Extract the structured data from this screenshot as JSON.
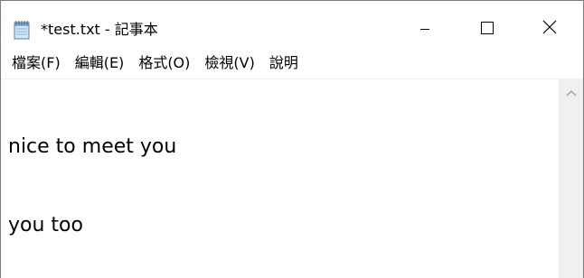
{
  "window": {
    "title": "*test.txt - 記事本",
    "app_icon": "notepad-icon",
    "controls": {
      "minimize_icon": "minimize-icon",
      "maximize_icon": "maximize-icon",
      "close_icon": "close-icon"
    }
  },
  "menu": {
    "items": [
      {
        "label": "檔案(F)"
      },
      {
        "label": "編輯(E)"
      },
      {
        "label": "格式(O)"
      },
      {
        "label": "檢視(V)"
      },
      {
        "label": "說明"
      }
    ]
  },
  "editor": {
    "lines": [
      "nice to meet you",
      "you too"
    ]
  },
  "scrollbar": {
    "up_icon": "chevron-up-icon"
  }
}
